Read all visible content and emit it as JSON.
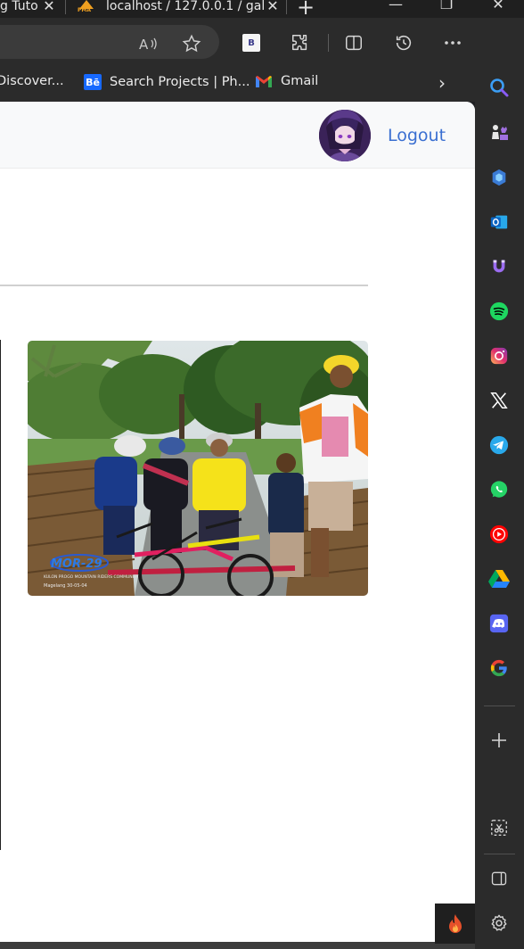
{
  "browser": {
    "tabs": [
      {
        "title": "g Tuto"
      },
      {
        "title": "localhost / 127.0.0.1 / gal"
      }
    ],
    "favicon_text": "PMA",
    "bookmarks": [
      {
        "label": "Discover..."
      },
      {
        "label": "Search Projects | Ph..."
      },
      {
        "label": "Gmail"
      }
    ],
    "extension_badge": "B",
    "be_icon_text": "Bē"
  },
  "page": {
    "nav": {
      "logout_label": "Logout"
    },
    "photo_caption": {
      "brand": "MOR-29",
      "subline": "KULON PROGO MOUNTAIN RIDERS COMMUNITY",
      "location_date": "Magelang 30-05-04"
    }
  },
  "colors": {
    "accent": "#3a6fd1",
    "tabbar_bg": "#1f1f1f",
    "toolbar_bg": "#2b2b2b",
    "navbar_bg": "#f8f9fa"
  },
  "sidebar_icons": [
    "search-icon",
    "chess-icon",
    "copilot-icon",
    "outlook-icon",
    "magnet-icon",
    "spotify-icon",
    "instagram-icon",
    "x-icon",
    "telegram-icon",
    "whatsapp-icon",
    "youtube-icon",
    "google-drive-icon",
    "discord-icon",
    "google-icon",
    "add-icon",
    "screenshot-icon",
    "panel-icon",
    "settings-icon"
  ]
}
